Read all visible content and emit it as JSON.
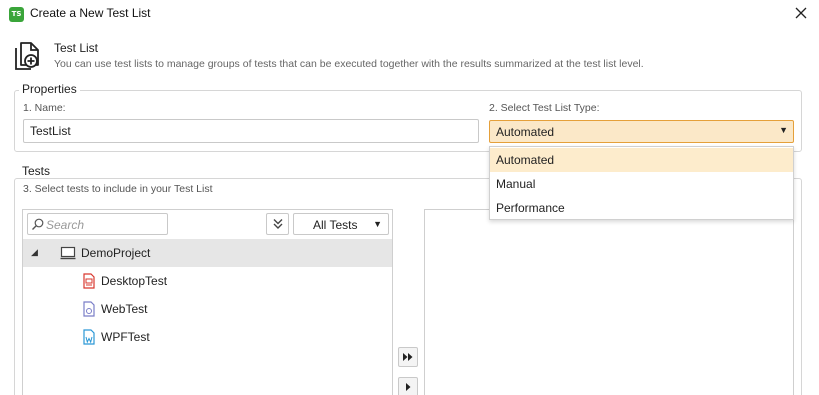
{
  "window": {
    "app_icon_text": "TS",
    "title": "Create a New Test List",
    "close_icon": "close-icon"
  },
  "header": {
    "icon": "new-test-list-icon",
    "title": "Test List",
    "description": "You can use test lists to manage groups of tests that can be executed together with the results summarized at the test list level."
  },
  "properties": {
    "legend": "Properties",
    "name_label": "1. Name:",
    "name_value": "TestList",
    "type_label": "2.  Select Test List Type:",
    "type_selected": "Automated",
    "type_options": [
      "Automated",
      "Manual",
      "Performance"
    ]
  },
  "tests": {
    "legend": "Tests",
    "instruction": "3.  Select tests to include in your Test List",
    "search_placeholder": "Search",
    "filter_label": "All Tests",
    "tree": [
      {
        "label": "DemoProject",
        "icon": "project-icon",
        "level": 0,
        "expanded": true,
        "selected": true
      },
      {
        "label": "DesktopTest",
        "icon": "desktop-test-icon",
        "level": 1
      },
      {
        "label": "WebTest",
        "icon": "web-test-icon",
        "level": 1
      },
      {
        "label": "WPFTest",
        "icon": "wpf-test-icon",
        "level": 1
      }
    ],
    "add_all_icon": "double-right-arrow-icon",
    "add_icon": "right-arrow-icon"
  },
  "colors": {
    "accent_fill": "#fbe8c8",
    "accent_border": "#e5a03a",
    "dropdown_highlight": "#fdeccc",
    "app_icon": "#3aa53a",
    "desktop_test": "#d9382f",
    "web_test": "#7a7ec8",
    "wpf_test": "#2b98d6"
  }
}
